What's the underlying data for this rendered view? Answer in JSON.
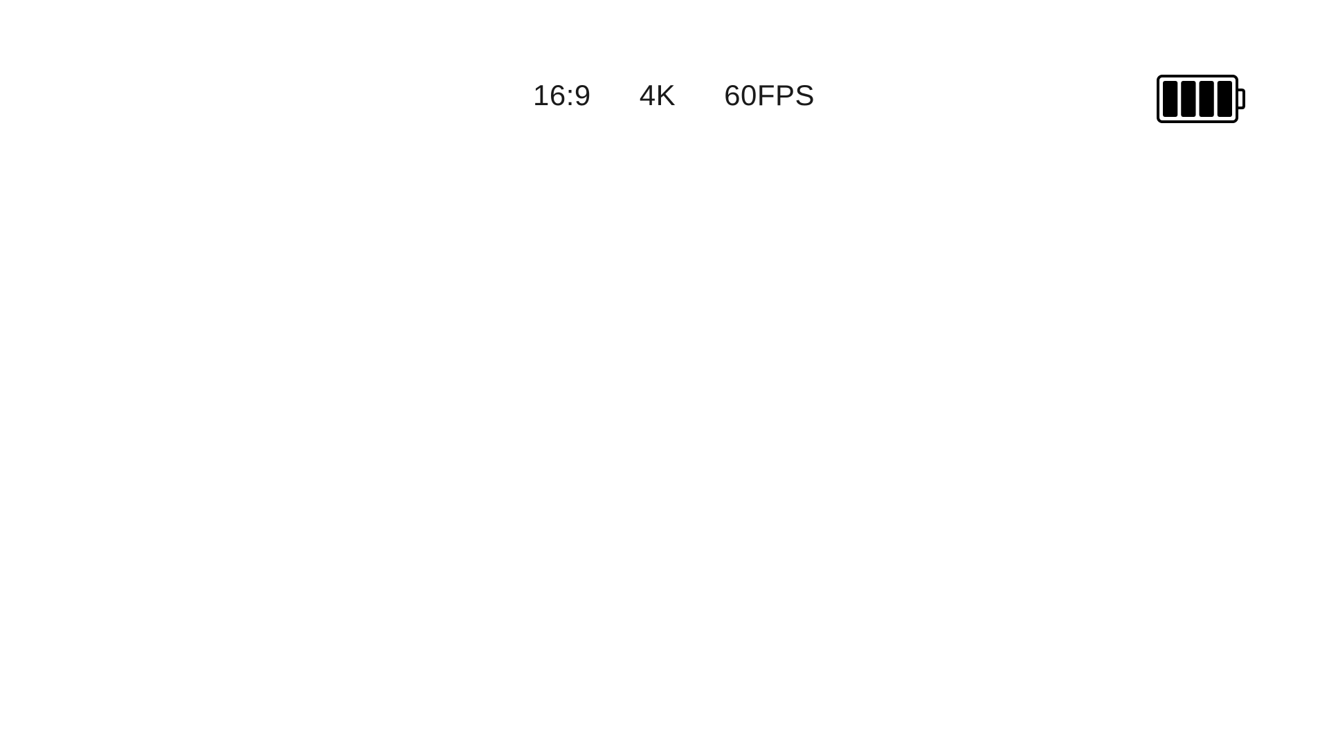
{
  "camera_status": {
    "aspect_ratio": "16:9",
    "resolution": "4K",
    "frame_rate": "60FPS"
  },
  "battery": {
    "icon": "battery-full-icon",
    "level_fraction": 1.0,
    "bars_filled": 4,
    "bars_total": 4,
    "color": "#000000"
  }
}
